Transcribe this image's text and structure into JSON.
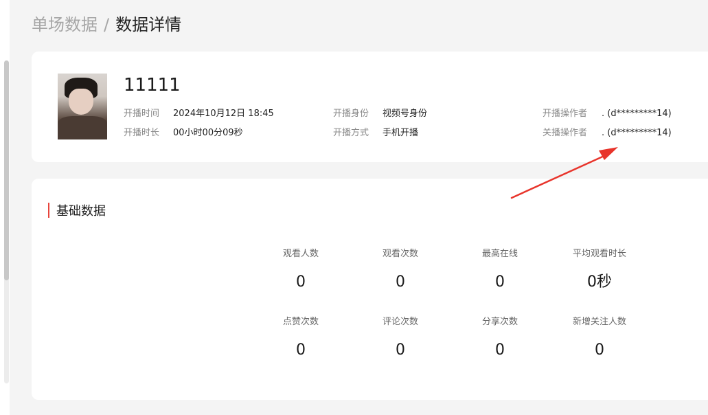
{
  "breadcrumb": {
    "previous": "单场数据",
    "separator": "/",
    "current": "数据详情"
  },
  "live": {
    "name": "11111",
    "fields": {
      "start_time": {
        "label": "开播时间",
        "value": "2024年10月12日 18:45"
      },
      "duration": {
        "label": "开播时长",
        "value": "00小时00分09秒"
      },
      "identity": {
        "label": "开播身份",
        "value": "视频号身份"
      },
      "method": {
        "label": "开播方式",
        "value": "手机开播"
      },
      "start_operator": {
        "label": "开播操作者",
        "value": ". (d*********14)"
      },
      "end_operator": {
        "label": "关播操作者",
        "value": ". (d*********14)"
      }
    }
  },
  "basic": {
    "title": "基础数据",
    "stats": [
      {
        "label": "观看人数",
        "value": "0"
      },
      {
        "label": "观看次数",
        "value": "0"
      },
      {
        "label": "最高在线",
        "value": "0"
      },
      {
        "label": "平均观看时长",
        "value": "0秒"
      },
      {
        "label": "点赞次数",
        "value": "0"
      },
      {
        "label": "评论次数",
        "value": "0"
      },
      {
        "label": "分享次数",
        "value": "0"
      },
      {
        "label": "新增关注人数",
        "value": "0"
      }
    ]
  },
  "colors": {
    "accent": "#e8453c",
    "annotation_arrow": "#e8342b"
  }
}
